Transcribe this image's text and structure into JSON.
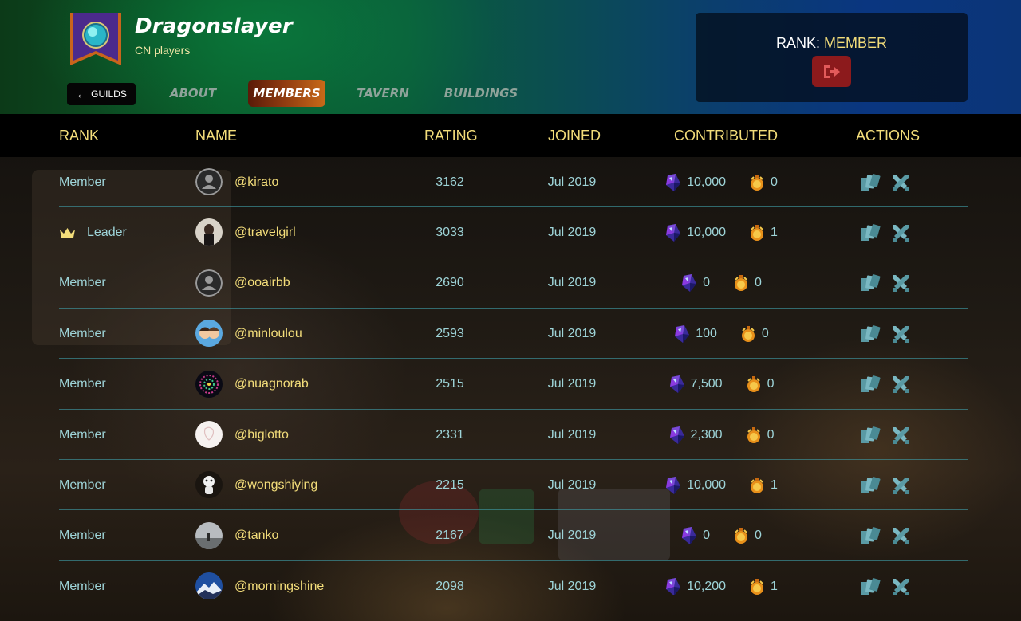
{
  "guild": {
    "name": "Dragonslayer",
    "subtitle": "CN players",
    "banner_icon": "guild-crystal-banner",
    "back_label": "GUILDS"
  },
  "tabs": [
    {
      "label": "ABOUT",
      "active": false
    },
    {
      "label": "MEMBERS",
      "active": true
    },
    {
      "label": "TAVERN",
      "active": false
    },
    {
      "label": "BUILDINGS",
      "active": false
    }
  ],
  "rank_panel": {
    "label": "RANK:",
    "value": "MEMBER",
    "leave_icon": "exit-door-icon"
  },
  "table": {
    "headers": {
      "rank": "RANK",
      "name": "NAME",
      "rating": "RATING",
      "joined": "JOINED",
      "contributed": "CONTRIBUTED",
      "actions": "ACTIONS"
    },
    "rows": [
      {
        "rank": "Member",
        "name": "@kirato",
        "rating": "3162",
        "joined": "Jul 2019",
        "dec": "10,000",
        "gold": "0",
        "avatar": "default"
      },
      {
        "rank": "Leader",
        "name": "@travelgirl",
        "rating": "3033",
        "joined": "Jul 2019",
        "dec": "10,000",
        "gold": "1",
        "avatar": "photo-dark",
        "crown": true
      },
      {
        "rank": "Member",
        "name": "@ooairbb",
        "rating": "2690",
        "joined": "Jul 2019",
        "dec": "0",
        "gold": "0",
        "avatar": "default"
      },
      {
        "rank": "Member",
        "name": "@minloulou",
        "rating": "2593",
        "joined": "Jul 2019",
        "dec": "100",
        "gold": "0",
        "avatar": "cartoon-couple"
      },
      {
        "rank": "Member",
        "name": "@nuagnorab",
        "rating": "2515",
        "joined": "Jul 2019",
        "dec": "7,500",
        "gold": "0",
        "avatar": "fireworks"
      },
      {
        "rank": "Member",
        "name": "@biglotto",
        "rating": "2331",
        "joined": "Jul 2019",
        "dec": "2,300",
        "gold": "0",
        "avatar": "white-sketch"
      },
      {
        "rank": "Member",
        "name": "@wongshiying",
        "rating": "2215",
        "joined": "Jul 2019",
        "dec": "10,000",
        "gold": "1",
        "avatar": "white-character"
      },
      {
        "rank": "Member",
        "name": "@tanko",
        "rating": "2167",
        "joined": "Jul 2019",
        "dec": "0",
        "gold": "0",
        "avatar": "grey-photo"
      },
      {
        "rank": "Member",
        "name": "@morningshine",
        "rating": "2098",
        "joined": "Jul 2019",
        "dec": "10,200",
        "gold": "1",
        "avatar": "mountain"
      }
    ]
  },
  "icons": {
    "dec": "dark-energy-crystal-icon",
    "gold": "gold-potion-icon",
    "cards": "view-cards-icon",
    "battle": "crossed-swords-icon"
  },
  "colors": {
    "accent": "#f3dd7a",
    "text_teal": "#9ed4d8",
    "divider": "#3e96a0",
    "leave_button": "#8c1a1c"
  }
}
